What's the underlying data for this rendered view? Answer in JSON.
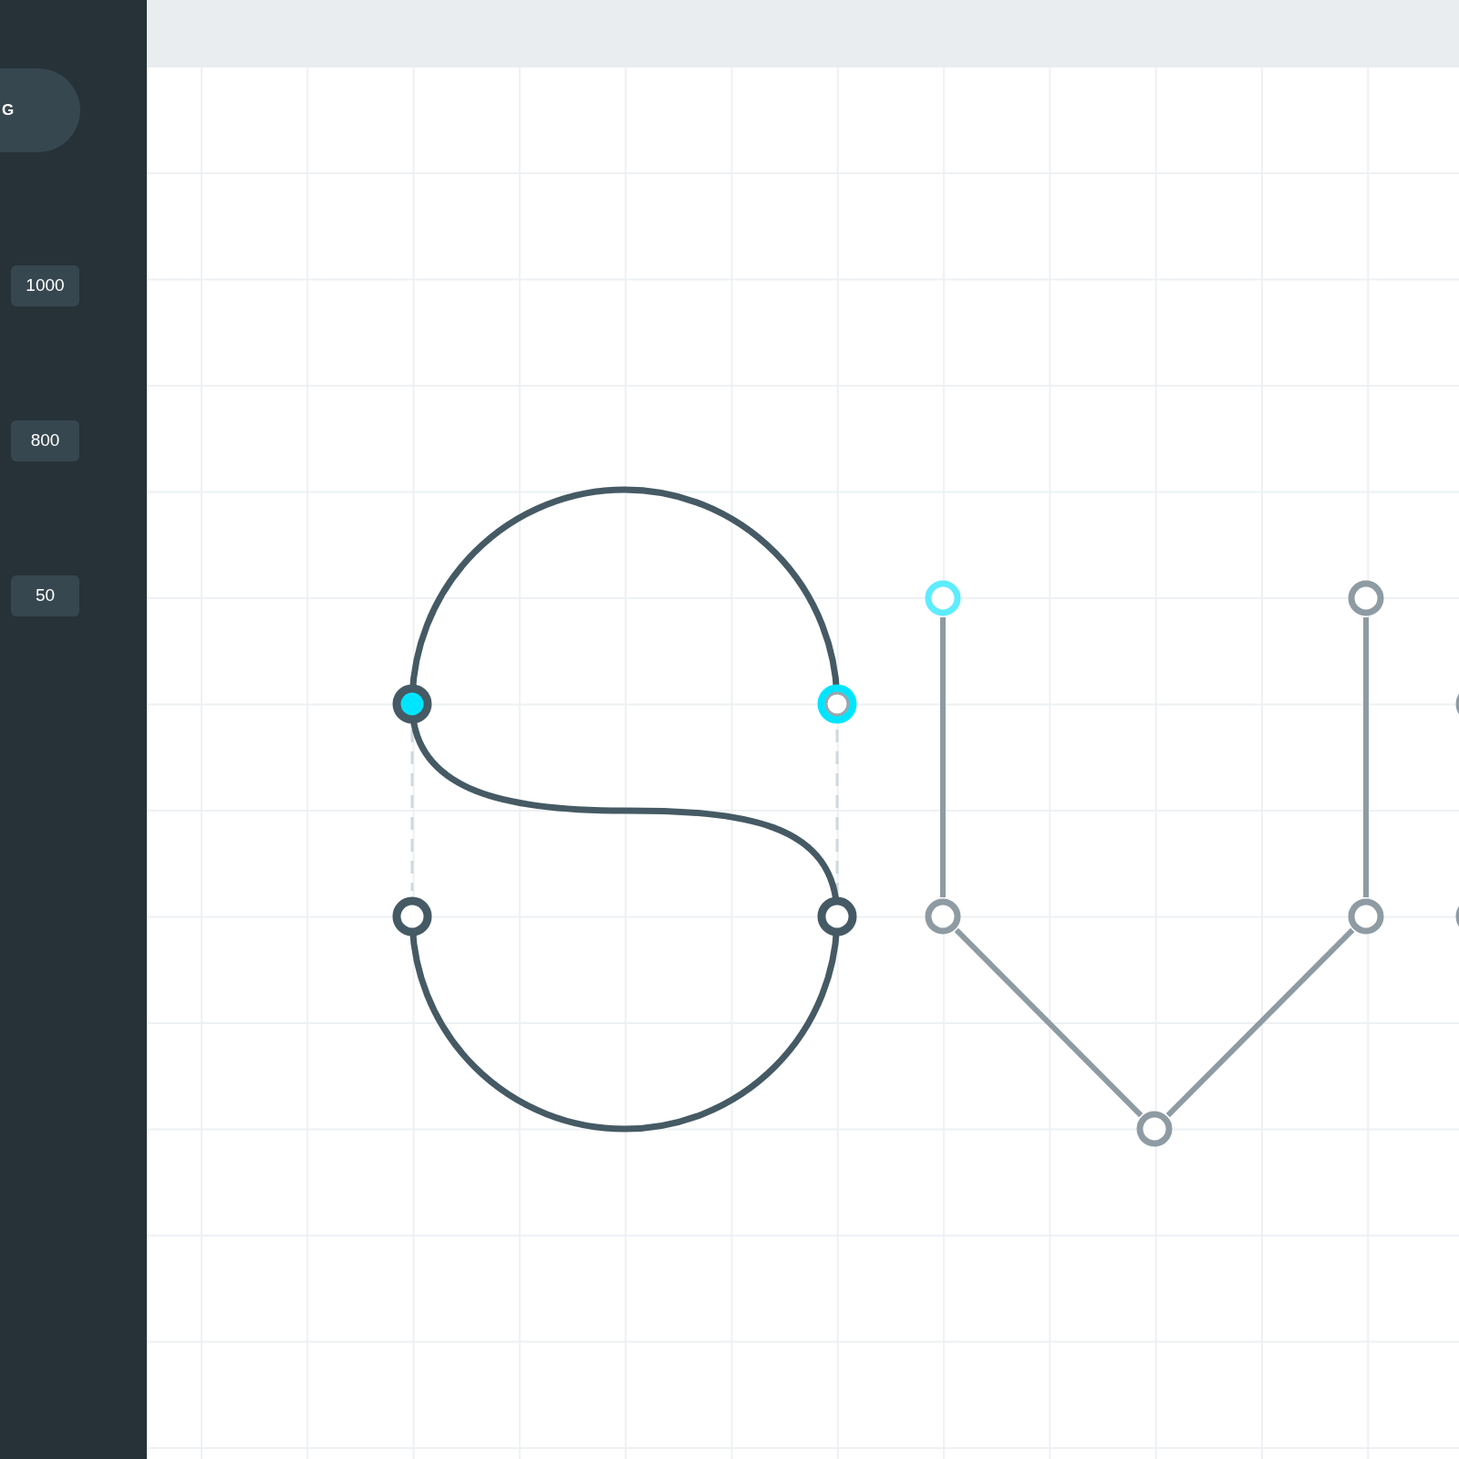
{
  "sidebar": {
    "button": {
      "label": "G"
    },
    "badges": [
      "1000",
      "800",
      "50"
    ]
  },
  "canvas": {
    "paths": [
      {
        "kind": "s-curve",
        "active": true,
        "anchors": [
          {
            "selected": true,
            "hovered": false
          },
          {
            "selected": false,
            "hovered": true
          },
          {
            "selected": false,
            "hovered": false
          },
          {
            "selected": false,
            "hovered": false
          }
        ]
      },
      {
        "kind": "polyline",
        "active": false,
        "anchors": [
          {
            "selected": false,
            "hovered": true
          },
          {
            "selected": false,
            "hovered": false
          },
          {
            "selected": false,
            "hovered": false
          },
          {
            "selected": false,
            "hovered": false
          },
          {
            "selected": false,
            "hovered": false
          }
        ]
      }
    ]
  }
}
